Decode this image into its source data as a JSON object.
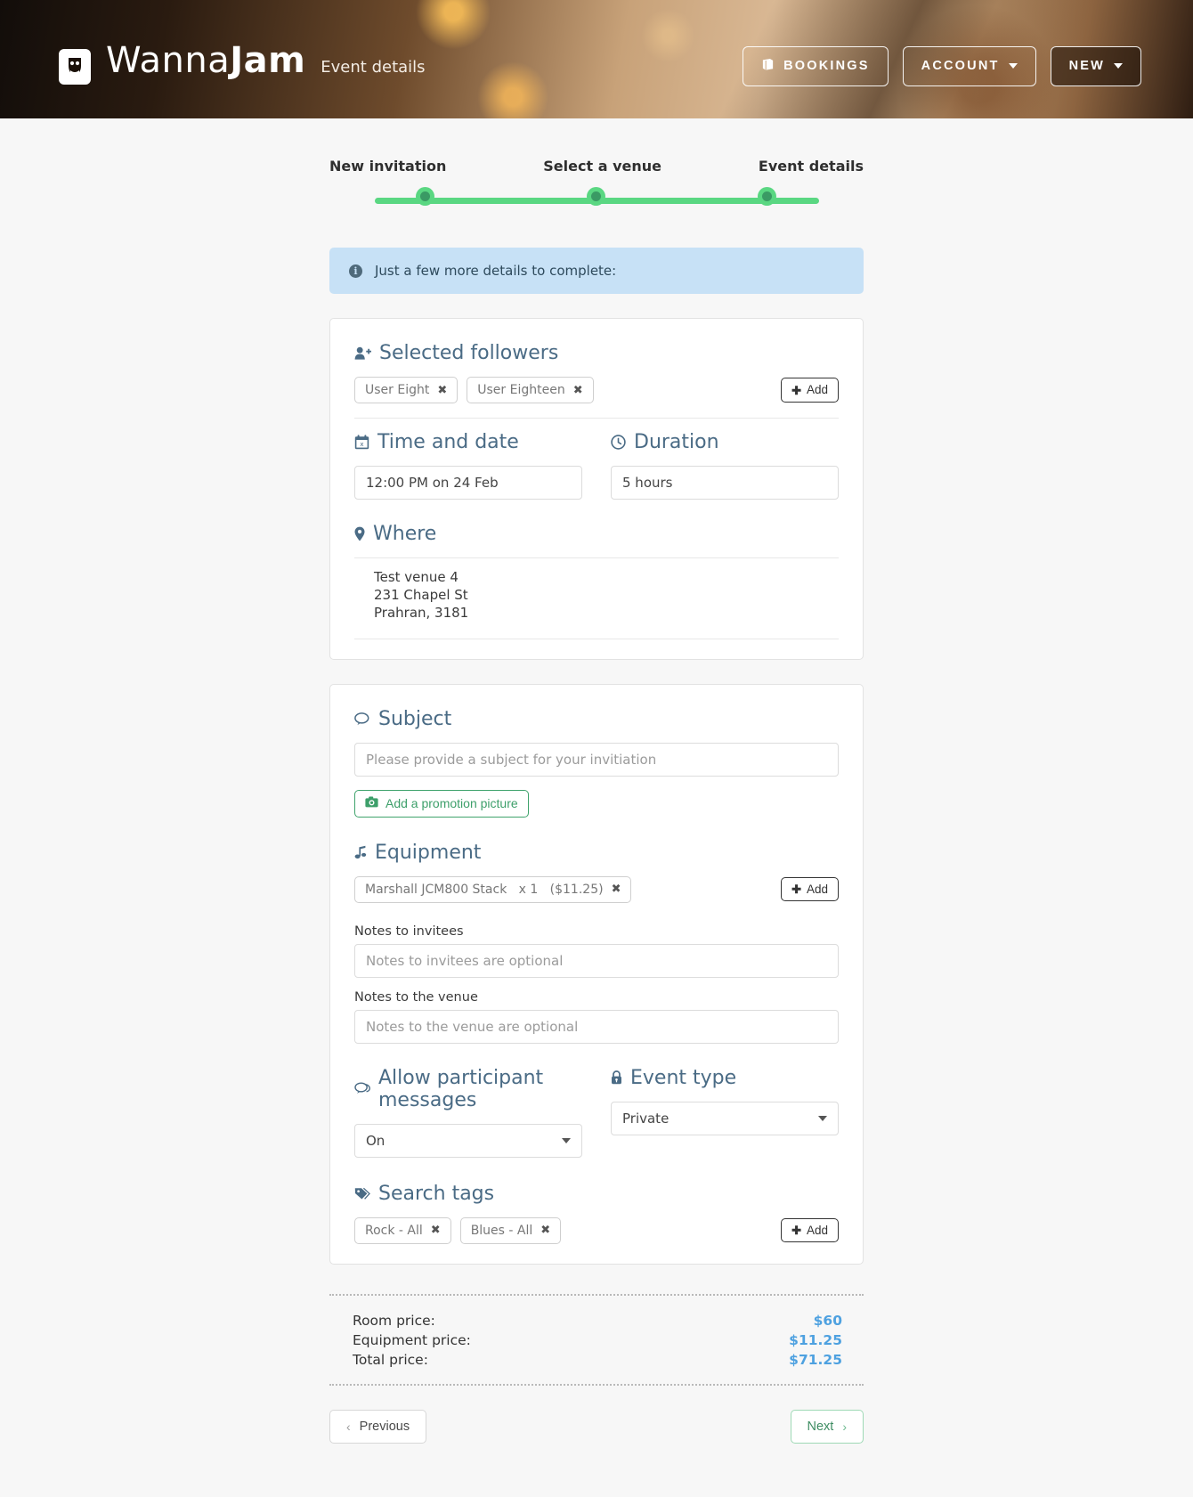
{
  "header": {
    "brand_prefix": "Wanna",
    "brand_suffix": "Jam",
    "page_subtitle": "Event details",
    "bookings_label": "BOOKINGS",
    "account_label": "ACCOUNT",
    "new_label": "NEW",
    "bookings_icon": "book-icon"
  },
  "wizard": {
    "steps": [
      {
        "label": "New invitation"
      },
      {
        "label": "Select a venue"
      },
      {
        "label": "Event details"
      }
    ],
    "accent_color": "#5ad782",
    "dot_inner_color": "#3a9a64"
  },
  "alert": {
    "icon": "info-icon",
    "text": "Just a few more details to complete:"
  },
  "followers": {
    "heading": "Selected followers",
    "icon": "user-plus-icon",
    "chips": [
      {
        "label": "User Eight"
      },
      {
        "label": "User Eighteen"
      }
    ],
    "add_label": "Add"
  },
  "time_and_date": {
    "heading": "Time and date",
    "icon": "calendar-icon",
    "value": "12:00 PM on 24 Feb"
  },
  "duration": {
    "heading": "Duration",
    "icon": "clock-icon",
    "value": "5 hours"
  },
  "where": {
    "heading": "Where",
    "icon": "map-pin-icon",
    "venue_name": "Test venue 4",
    "address_line": "231 Chapel St",
    "suburb_postcode": "Prahran, 3181"
  },
  "subject": {
    "heading": "Subject",
    "icon": "speech-bubble-icon",
    "value": "",
    "placeholder": "Please provide a subject for your invitiation",
    "promo_button_label": "Add a promotion picture",
    "promo_button_icon": "camera-icon"
  },
  "equipment": {
    "heading": "Equipment",
    "icon": "music-note-icon",
    "chips": [
      {
        "label": "Marshall JCM800 Stack   x 1   ($11.25)"
      }
    ],
    "add_label": "Add",
    "notes_invitees_label": "Notes to invitees",
    "notes_invitees_value": "",
    "notes_invitees_placeholder": "Notes to invitees are optional",
    "notes_venue_label": "Notes to the venue",
    "notes_venue_value": "",
    "notes_venue_placeholder": "Notes to the venue are optional"
  },
  "participant_messages": {
    "heading": "Allow participant messages",
    "icon": "comments-icon",
    "selected": "On"
  },
  "event_type": {
    "heading": "Event type",
    "icon": "lock-icon",
    "selected": "Private"
  },
  "search_tags": {
    "heading": "Search tags",
    "icon": "tag-icon",
    "chips": [
      {
        "label": "Rock - All"
      },
      {
        "label": "Blues - All"
      }
    ],
    "add_label": "Add"
  },
  "prices": {
    "room_label": "Room price:",
    "room_value": "$60",
    "equipment_label": "Equipment price:",
    "equipment_value": "$11.25",
    "total_label": "Total price:",
    "total_value": "$71.25",
    "value_color": "#4ea1e0"
  },
  "footer": {
    "previous_label": "Previous",
    "next_label": "Next",
    "previous_icon": "chevron-left-icon",
    "next_icon": "chevron-right-icon"
  }
}
